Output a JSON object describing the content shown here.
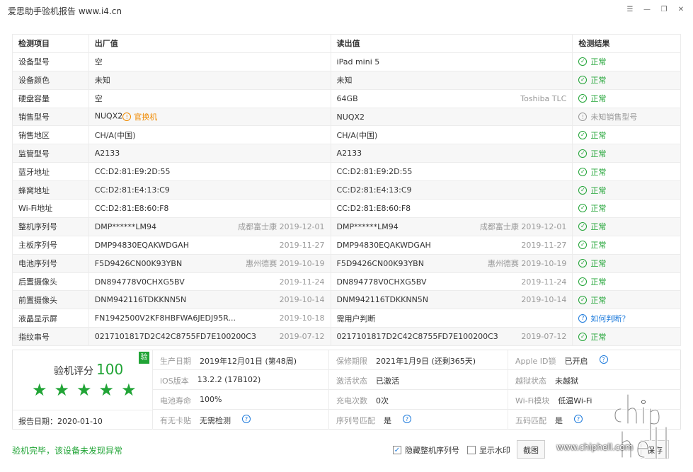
{
  "window": {
    "title": "爱思助手验机报告 www.i4.cn"
  },
  "table": {
    "headers": [
      "检测项目",
      "出厂值",
      "读出值",
      "检测结果"
    ],
    "rows": [
      {
        "item": "设备型号",
        "factory": "空",
        "factory_note": "",
        "read": "iPad mini 5",
        "read_note": "",
        "result": "正常",
        "status": "ok"
      },
      {
        "item": "设备颜色",
        "factory": "未知",
        "factory_note": "",
        "read": "未知",
        "read_note": "",
        "result": "正常",
        "status": "ok"
      },
      {
        "item": "硬盘容量",
        "factory": "空",
        "factory_note": "",
        "read": "64GB",
        "read_note": "Toshiba TLC",
        "result": "正常",
        "status": "ok"
      },
      {
        "item": "销售型号",
        "factory": "NUQX2",
        "factory_tag": "官换机",
        "factory_note": "",
        "read": "NUQX2",
        "read_note": "",
        "result": "未知销售型号",
        "status": "unknown"
      },
      {
        "item": "销售地区",
        "factory": "CH/A(中国)",
        "factory_note": "",
        "read": "CH/A(中国)",
        "read_note": "",
        "result": "正常",
        "status": "ok"
      },
      {
        "item": "监管型号",
        "factory": "A2133",
        "factory_note": "",
        "read": "A2133",
        "read_note": "",
        "result": "正常",
        "status": "ok"
      },
      {
        "item": "蓝牙地址",
        "factory": "CC:D2:81:E9:2D:55",
        "factory_note": "",
        "read": "CC:D2:81:E9:2D:55",
        "read_note": "",
        "result": "正常",
        "status": "ok"
      },
      {
        "item": "蜂窝地址",
        "factory": "CC:D2:81:E4:13:C9",
        "factory_note": "",
        "read": "CC:D2:81:E4:13:C9",
        "read_note": "",
        "result": "正常",
        "status": "ok"
      },
      {
        "item": "Wi-Fi地址",
        "factory": "CC:D2:81:E8:60:F8",
        "factory_note": "",
        "read": "CC:D2:81:E8:60:F8",
        "read_note": "",
        "result": "正常",
        "status": "ok"
      },
      {
        "item": "整机序列号",
        "factory": "DMP******LM94",
        "factory_note": "成都富士康  2019-12-01",
        "read": "DMP******LM94",
        "read_note": "成都富士康  2019-12-01",
        "result": "正常",
        "status": "ok"
      },
      {
        "item": "主板序列号",
        "factory": "DMP94830EQAKWDGAH",
        "factory_note": "2019-11-27",
        "read": "DMP94830EQAKWDGAH",
        "read_note": "2019-11-27",
        "result": "正常",
        "status": "ok"
      },
      {
        "item": "电池序列号",
        "factory": "F5D9426CN00K93YBN",
        "factory_note": "惠州德赛  2019-10-19",
        "read": "F5D9426CN00K93YBN",
        "read_note": "惠州德赛  2019-10-19",
        "result": "正常",
        "status": "ok"
      },
      {
        "item": "后置摄像头",
        "factory": "DN894778V0CHXG5BV",
        "factory_note": "2019-11-24",
        "read": "DN894778V0CHXG5BV",
        "read_note": "2019-11-24",
        "result": "正常",
        "status": "ok"
      },
      {
        "item": "前置摄像头",
        "factory": "DNM942116TDKKNN5N",
        "factory_note": "2019-10-14",
        "read": "DNM942116TDKKNN5N",
        "read_note": "2019-10-14",
        "result": "正常",
        "status": "ok"
      },
      {
        "item": "液晶显示屏",
        "factory": "FN1942500V2KF8HBFWA6JEDJ95R...",
        "factory_note": "2019-10-18",
        "read": "需用户判断",
        "read_note": "",
        "result": "如何判断？",
        "status": "help"
      },
      {
        "item": "指纹串号",
        "factory": "0217101817D2C42C8755FD7E100200C3",
        "factory_note": "2019-07-12",
        "read": "0217101817D2C42C8755FD7E100200C3",
        "read_note": "2019-07-12",
        "result": "正常",
        "status": "ok"
      }
    ]
  },
  "summary": {
    "score_label": "验机评分",
    "score": "100",
    "badge": "验",
    "stars": 5,
    "report_date": "报告日期：2020-01-10",
    "fields": {
      "prod_date_k": "生产日期",
      "prod_date_v": "2019年12月01日 (第48周)",
      "warranty_k": "保修期限",
      "warranty_v": "2021年1月9日 (还剩365天)",
      "appleid_k": "Apple ID锁",
      "appleid_v": "已开启",
      "ios_k": "iOS版本",
      "ios_v": "13.2.2 (17B102)",
      "activation_k": "激活状态",
      "activation_v": "已激活",
      "jailbreak_k": "越狱状态",
      "jailbreak_v": "未越狱",
      "battery_k": "电池寿命",
      "battery_v": "100%",
      "charge_k": "充电次数",
      "charge_v": "0次",
      "wifi_k": "Wi-Fi模块",
      "wifi_v": "低温Wi-Fi",
      "sim_k": "有无卡贴",
      "sim_v": "无需检测",
      "serial_match_k": "序列号匹配",
      "serial_match_v": "是",
      "fivecode_k": "五码匹配",
      "fivecode_v": "是"
    }
  },
  "footer": {
    "message": "验机完毕，该设备未发现异常",
    "hide_serial": "隐藏整机序列号",
    "show_watermark": "显示水印",
    "screenshot_btn": "截图",
    "save_btn": "保存",
    "watermark_text": "www.chiphell.com"
  },
  "colors": {
    "ok": "#21a436",
    "warn": "#f08a00",
    "link": "#1e7bdc",
    "danger": "#e02020"
  }
}
